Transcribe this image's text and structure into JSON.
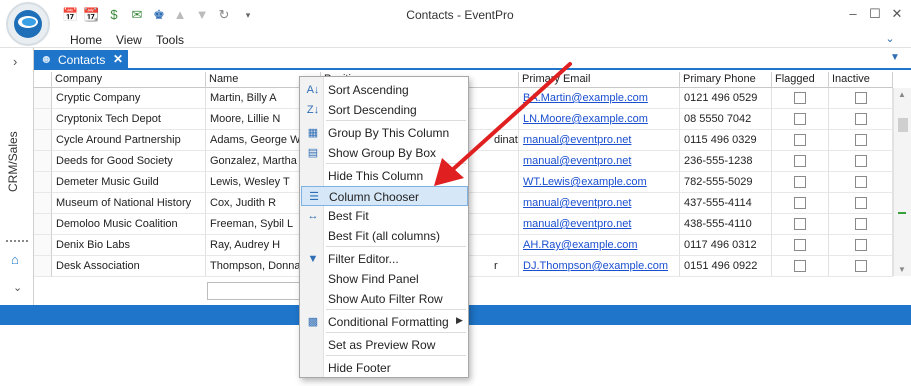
{
  "window": {
    "title": "Contacts - EventPro",
    "menu": [
      "Home",
      "View",
      "Tools"
    ],
    "minimize": "–",
    "restore": "☐",
    "close": "✕"
  },
  "sidebar": {
    "label": "CRM/Sales"
  },
  "tab": {
    "label": "Contacts",
    "close": "✕"
  },
  "grid": {
    "columns": [
      "Company",
      "Name",
      "Position",
      "Primary Email",
      "Primary Phone",
      "Flagged",
      "Inactive"
    ],
    "rows": [
      {
        "company": "Cryptic Company",
        "name": "Martin, Billy A",
        "email": "BA.Martin@example.com",
        "phone": "0121 496 0529"
      },
      {
        "company": "Cryptonix Tech Depot",
        "name": "Moore, Lillie N",
        "email": "LN.Moore@example.com",
        "phone": "08 5550 7042"
      },
      {
        "company": "Cycle Around Partnership",
        "name": "Adams, George W",
        "email": "manual@eventpro.net",
        "phone": "0115 496 0329"
      },
      {
        "company": "Deeds for Good Society",
        "name": "Gonzalez, Martha K",
        "email": "manual@eventpro.net",
        "phone": "236-555-1238"
      },
      {
        "company": "Demeter Music Guild",
        "name": "Lewis, Wesley T",
        "email": "WT.Lewis@example.com",
        "phone": "782-555-5029"
      },
      {
        "company": "Museum of National History",
        "name": "Cox, Judith R",
        "email": "manual@eventpro.net",
        "phone": "437-555-4114"
      },
      {
        "company": "Demoloo Music Coalition",
        "name": "Freeman, Sybil L",
        "email": "manual@eventpro.net",
        "phone": "438-555-4110"
      },
      {
        "company": "Denix Bio Labs",
        "name": "Ray, Audrey H",
        "email": "AH.Ray@example.com",
        "phone": "0117 496 0312"
      },
      {
        "company": "Desk Association",
        "name": "Thompson, Donna",
        "email": "DJ.Thompson@example.com",
        "phone": "0151 496 0922"
      }
    ],
    "position_fragments": [
      "dinator",
      "r"
    ]
  },
  "context_menu": {
    "items": [
      {
        "label": "Sort Ascending",
        "icon": "sort-ascending-icon"
      },
      {
        "label": "Sort Descending",
        "icon": "sort-descending-icon"
      },
      {
        "label": "Group By This Column",
        "icon": "group-by-icon"
      },
      {
        "label": "Show Group By Box",
        "icon": "group-box-icon"
      },
      {
        "label": "Hide This Column",
        "icon": ""
      },
      {
        "label": "Column Chooser",
        "icon": "column-chooser-icon"
      },
      {
        "label": "Best Fit",
        "icon": "best-fit-icon"
      },
      {
        "label": "Best Fit (all columns)",
        "icon": ""
      },
      {
        "label": "Filter Editor...",
        "icon": "filter-icon"
      },
      {
        "label": "Show Find Panel",
        "icon": ""
      },
      {
        "label": "Show Auto Filter Row",
        "icon": ""
      },
      {
        "label": "Conditional Formatting",
        "icon": "conditional-formatting-icon"
      },
      {
        "label": "Set as Preview Row",
        "icon": ""
      },
      {
        "label": "Hide Footer",
        "icon": ""
      }
    ],
    "highlighted": "Column Chooser"
  },
  "colors": {
    "accent": "#1e75c9",
    "arrow": "#e02020"
  }
}
